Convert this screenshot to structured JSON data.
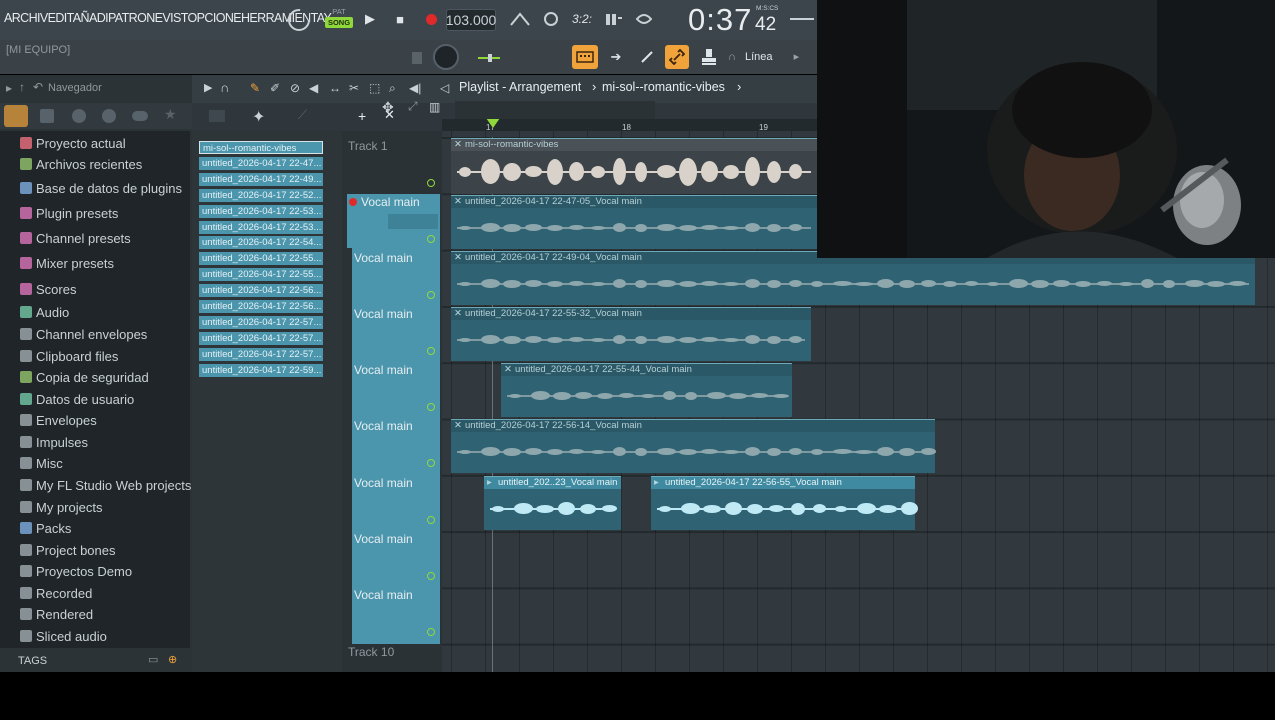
{
  "menu": [
    "ARCHIV",
    "EDIT",
    "AÑADI",
    "PATRON",
    "EVISTO",
    "PCIONE",
    "HERRAMIENTA",
    "Y"
  ],
  "transport": {
    "pat": "PAT",
    "song": "SONG",
    "tempo": "103.000",
    "time_main": "0:37",
    "time_sub": "42",
    "time_label": "M:S:CS"
  },
  "row2": {
    "hint": "[MI EQUIPO]",
    "snap_label": "Línea"
  },
  "browser": {
    "title": "Navegador",
    "items": [
      {
        "label": "Proyecto actual",
        "icon": "project-icon",
        "color": "#e06c7a"
      },
      {
        "label": "Archivos recientes",
        "icon": "recent-files-icon",
        "color": "#8fbc6a"
      },
      {
        "label": "Base de datos de plugins",
        "icon": "plugin-database-icon",
        "color": "#7aa6d6"
      },
      {
        "label": "Plugin presets",
        "icon": "plugin-presets-icon",
        "color": "#d070b0"
      },
      {
        "label": "Channel presets",
        "icon": "channel-presets-icon",
        "color": "#d070b0"
      },
      {
        "label": "Mixer presets",
        "icon": "mixer-presets-icon",
        "color": "#d070b0"
      },
      {
        "label": "Scores",
        "icon": "score-note-icon",
        "color": "#d070b0"
      },
      {
        "label": "Audio",
        "icon": "audio-icon",
        "color": "#70c0a0"
      },
      {
        "label": "Channel envelopes",
        "icon": "folder-icon",
        "color": "#9aa3a8"
      },
      {
        "label": "Clipboard files",
        "icon": "folder-icon",
        "color": "#9aa3a8"
      },
      {
        "label": "Copia de seguridad",
        "icon": "backup-icon",
        "color": "#8fbc6a"
      },
      {
        "label": "Datos de usuario",
        "icon": "user-data-icon",
        "color": "#70c0a0"
      },
      {
        "label": "Envelopes",
        "icon": "folder-icon",
        "color": "#9aa3a8"
      },
      {
        "label": "Impulses",
        "icon": "folder-icon",
        "color": "#9aa3a8"
      },
      {
        "label": "Misc",
        "icon": "folder-icon",
        "color": "#9aa3a8"
      },
      {
        "label": "My FL Studio Web projects",
        "icon": "folder-icon",
        "color": "#9aa3a8"
      },
      {
        "label": "My projects",
        "icon": "folder-icon",
        "color": "#9aa3a8"
      },
      {
        "label": "Packs",
        "icon": "packs-icon",
        "color": "#7aa6d6"
      },
      {
        "label": "Project bones",
        "icon": "folder-icon",
        "color": "#9aa3a8"
      },
      {
        "label": "Proyectos Demo",
        "icon": "folder-icon",
        "color": "#9aa3a8"
      },
      {
        "label": "Recorded",
        "icon": "recorded-icon",
        "color": "#9aa3a8"
      },
      {
        "label": "Rendered",
        "icon": "rendered-icon",
        "color": "#9aa3a8"
      },
      {
        "label": "Sliced audio",
        "icon": "sliced-audio-icon",
        "color": "#9aa3a8"
      }
    ],
    "tags_label": "TAGS"
  },
  "picker": [
    "mi-sol--romantic-vibes",
    "untitled_2026-04-17 22-47...",
    "untitled_2026-04-17 22-49...",
    "untitled_2026-04-17 22-52...",
    "untitled_2026-04-17 22-53...",
    "untitled_2026-04-17 22-53...",
    "untitled_2026-04-17 22-54...",
    "untitled_2026-04-17 22-55...",
    "untitled_2026-04-17 22-55...",
    "untitled_2026-04-17 22-56...",
    "untitled_2026-04-17 22-56...",
    "untitled_2026-04-17 22-57...",
    "untitled_2026-04-17 22-57...",
    "untitled_2026-04-17 22-57...",
    "untitled_2026-04-17 22-59..."
  ],
  "playlist": {
    "breadcrumb_view": "Playlist - Arrangement",
    "breadcrumb_sep": "›",
    "breadcrumb_pattern": "mi-sol--romantic-vibes",
    "ruler_marks": [
      "17",
      "18",
      "19"
    ],
    "tracks": [
      "Track 1",
      "Vocal main",
      "Vocal main",
      "Vocal main",
      "Vocal main",
      "Vocal main",
      "Vocal main",
      "Vocal main",
      "Vocal main",
      "Track 10"
    ],
    "clips": [
      {
        "title": "mi-sol--romantic-vibes"
      },
      {
        "title": "untitled_2026-04-17 22-47-05_Vocal main"
      },
      {
        "title": "untitled_2026-04-17 22-49-04_Vocal main"
      },
      {
        "title": "untitled_2026-04-17 22-55-32_Vocal main"
      },
      {
        "title": "untitled_2026-04-17 22-55-44_Vocal main"
      },
      {
        "title": "untitled_2026-04-17 22-56-14_Vocal main"
      },
      {
        "title": "untitled_202..23_Vocal main"
      },
      {
        "title": "untitled_2026-04-17 22-56-55_Vocal main"
      }
    ]
  },
  "colors": {
    "accent": "#f0a33a",
    "song_green": "#8fd83a",
    "clip_teal": "#4b96ad",
    "record_red": "#e02a2a"
  }
}
